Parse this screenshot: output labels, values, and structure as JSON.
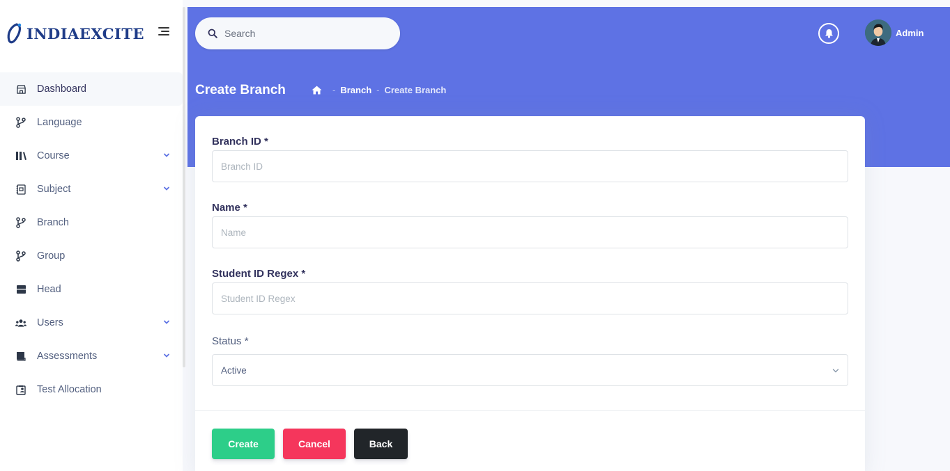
{
  "brand": {
    "name": "INDIAEXCITE",
    "logo_icon": "indiaexcite-logo-icon"
  },
  "sidebar": {
    "items": [
      {
        "label": "Dashboard",
        "icon": "shop-icon",
        "active": true,
        "has_submenu": false
      },
      {
        "label": "Language",
        "icon": "git-branch-icon",
        "active": false,
        "has_submenu": false
      },
      {
        "label": "Course",
        "icon": "books-icon",
        "active": false,
        "has_submenu": true
      },
      {
        "label": "Subject",
        "icon": "subject-icon",
        "active": false,
        "has_submenu": true
      },
      {
        "label": "Branch",
        "icon": "git-branch-icon",
        "active": false,
        "has_submenu": false
      },
      {
        "label": "Group",
        "icon": "git-branch-icon",
        "active": false,
        "has_submenu": false
      },
      {
        "label": "Head",
        "icon": "archive-icon",
        "active": false,
        "has_submenu": false
      },
      {
        "label": "Users",
        "icon": "users-icon",
        "active": false,
        "has_submenu": true
      },
      {
        "label": "Assessments",
        "icon": "book-icon",
        "active": false,
        "has_submenu": true
      },
      {
        "label": "Test Allocation",
        "icon": "clipboard-user-icon",
        "active": false,
        "has_submenu": false
      }
    ]
  },
  "header": {
    "search_placeholder": "Search",
    "user_name": "Admin"
  },
  "page": {
    "title": "Create Branch",
    "breadcrumb": [
      "Branch",
      "Create Branch"
    ]
  },
  "form": {
    "branch_id": {
      "label": "Branch ID *",
      "placeholder": "Branch ID",
      "value": ""
    },
    "name": {
      "label": "Name *",
      "placeholder": "Name",
      "value": ""
    },
    "student_id_regex": {
      "label": "Student ID Regex *",
      "placeholder": "Student ID Regex",
      "value": ""
    },
    "status": {
      "label": "Status *",
      "selected": "Active"
    }
  },
  "actions": {
    "create": "Create",
    "cancel": "Cancel",
    "back": "Back"
  },
  "colors": {
    "primary": "#5e72e4",
    "success": "#2dce89",
    "danger": "#f5365c",
    "dark": "#212529",
    "chevron": "#5e72e4"
  }
}
